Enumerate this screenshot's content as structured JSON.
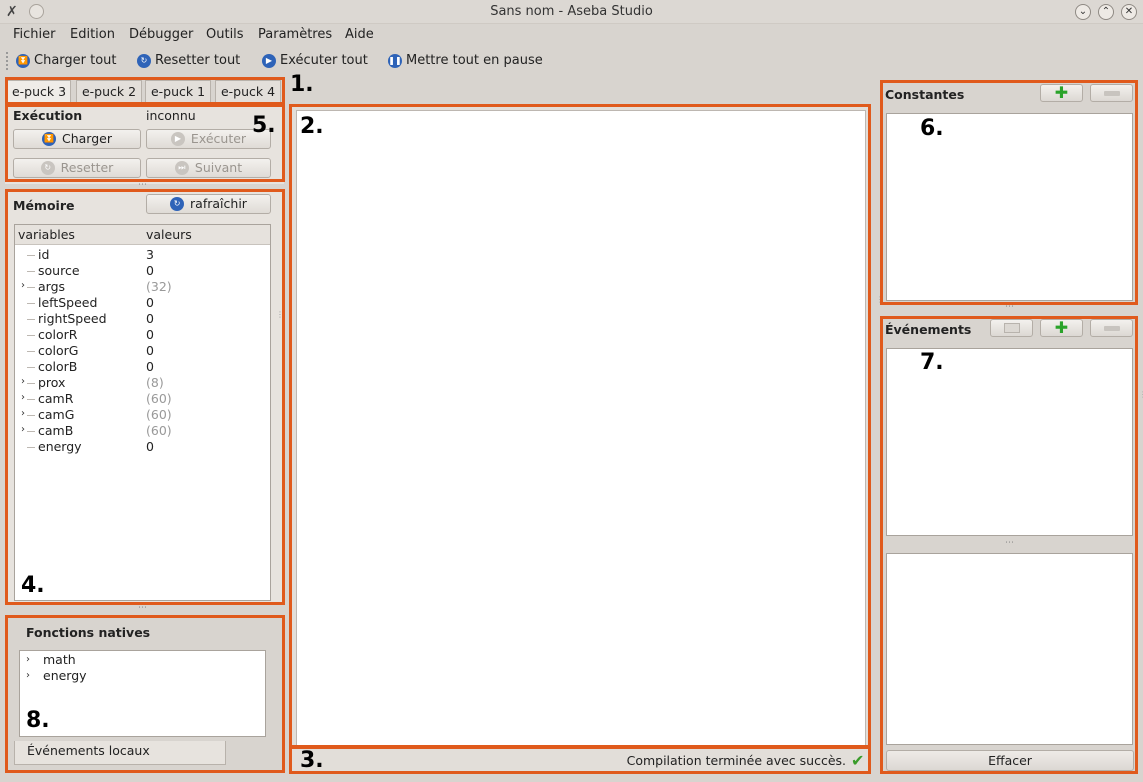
{
  "window": {
    "title": "Sans nom  - Aseba Studio"
  },
  "menu": [
    "Fichier",
    "Edition",
    "Débugger",
    "Outils",
    "Paramètres",
    "Aide"
  ],
  "toolbar": {
    "load_all": "Charger tout",
    "reset_all": "Resetter tout",
    "run_all": "Exécuter tout",
    "pause_all": "Mettre tout en pause"
  },
  "tabs": [
    "e-puck 3",
    "e-puck 2",
    "e-puck 1",
    "e-puck 4"
  ],
  "execution": {
    "title": "Exécution",
    "state": "inconnu",
    "load": "Charger",
    "run": "Exécuter",
    "reset": "Resetter",
    "next": "Suivant"
  },
  "memory": {
    "title": "Mémoire",
    "refresh": "rafraîchir",
    "col_vars": "variables",
    "col_vals": "valeurs",
    "rows": [
      {
        "name": "id",
        "value": "3",
        "expandable": false
      },
      {
        "name": "source",
        "value": "0",
        "expandable": false
      },
      {
        "name": "args",
        "value": "(32)",
        "expandable": true
      },
      {
        "name": "leftSpeed",
        "value": "0",
        "expandable": false
      },
      {
        "name": "rightSpeed",
        "value": "0",
        "expandable": false
      },
      {
        "name": "colorR",
        "value": "0",
        "expandable": false
      },
      {
        "name": "colorG",
        "value": "0",
        "expandable": false
      },
      {
        "name": "colorB",
        "value": "0",
        "expandable": false
      },
      {
        "name": "prox",
        "value": "(8)",
        "expandable": true
      },
      {
        "name": "camR",
        "value": "(60)",
        "expandable": true
      },
      {
        "name": "camG",
        "value": "(60)",
        "expandable": true
      },
      {
        "name": "camB",
        "value": "(60)",
        "expandable": true
      },
      {
        "name": "energy",
        "value": "0",
        "expandable": false
      }
    ]
  },
  "native_functions": {
    "title": "Fonctions natives",
    "items": [
      "math",
      "energy"
    ],
    "tab": "Événements locaux"
  },
  "status": {
    "message": "Compilation terminée avec succès."
  },
  "constants": {
    "title": "Constantes"
  },
  "events": {
    "title": "Événements",
    "clear": "Effacer"
  },
  "annotations": [
    "1.",
    "2.",
    "3.",
    "4.",
    "5.",
    "6.",
    "7.",
    "8."
  ],
  "colors": {
    "highlight": "#e05a1c",
    "success": "#3a9c2a",
    "accent": "#2e63b8"
  }
}
